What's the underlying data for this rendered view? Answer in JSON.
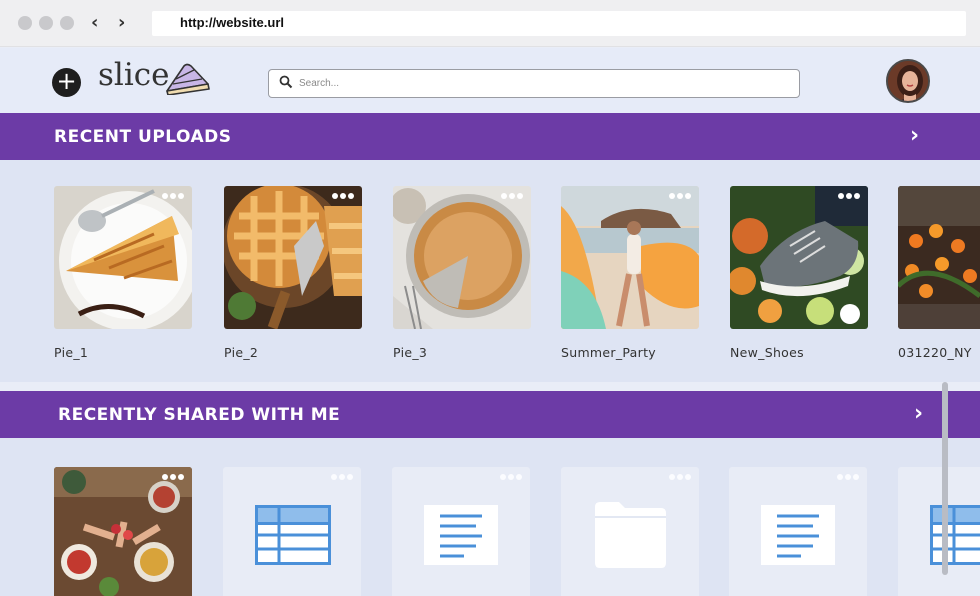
{
  "browser": {
    "url": "http://website.url",
    "back_icon": "chevron-left-icon",
    "forward_icon": "chevron-right-icon"
  },
  "header": {
    "add_icon": "plus-icon",
    "logo_text": "slice",
    "logo_icon": "pie-slice-icon",
    "search_placeholder": "Search...",
    "search_icon": "search-icon"
  },
  "sections": [
    {
      "title": "RECENT UPLOADS",
      "arrow_icon": "chevron-right-icon",
      "items": [
        {
          "name": "Pie_1"
        },
        {
          "name": "Pie_2"
        },
        {
          "name": "Pie_3"
        },
        {
          "name": "Summer_Party"
        },
        {
          "name": "New_Shoes"
        },
        {
          "name": "031220_NY"
        }
      ]
    },
    {
      "title": "RECENTLY SHARED WITH ME",
      "arrow_icon": "chevron-right-icon",
      "items": [
        {
          "icon": "photo-thumbnail"
        },
        {
          "icon": "spreadsheet-icon"
        },
        {
          "icon": "document-icon"
        },
        {
          "icon": "folder-icon"
        },
        {
          "icon": "document-icon"
        },
        {
          "icon": "spreadsheet-icon"
        }
      ]
    }
  ],
  "colors": {
    "accent": "#6c3ba6",
    "file_icon_blue": "#4a90d9"
  }
}
